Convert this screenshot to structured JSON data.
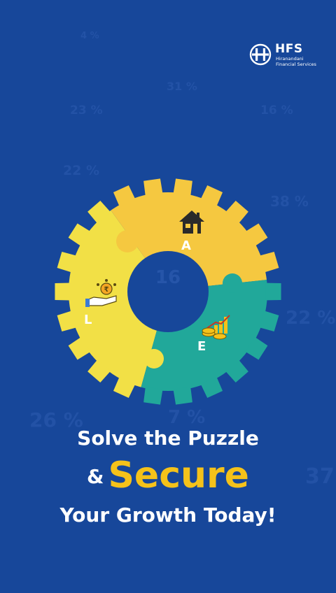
{
  "brand": {
    "name": "HFS",
    "subtitle_line1": "Hiranandani",
    "subtitle_line2": "Financial Services"
  },
  "background_numbers": [
    "4 %",
    "31 %",
    "23 %",
    "16 %",
    "22 %",
    "38 %",
    "16",
    "22 %",
    "26 %",
    "7 %",
    "37"
  ],
  "puzzle": {
    "pieces": [
      {
        "letter": "A",
        "icon": "house-icon",
        "color": "#f5c840"
      },
      {
        "letter": "L",
        "icon": "hand-rupee-icon",
        "color": "#f2e046"
      },
      {
        "letter": "E",
        "icon": "growth-chart-coins-icon",
        "color": "#21a89a"
      }
    ]
  },
  "headline": {
    "line1": "Solve the Puzzle",
    "amp": "&",
    "highlight": "Secure",
    "line3": "Your Growth Today!"
  },
  "colors": {
    "background": "#17479a",
    "highlight": "#f5c21a"
  }
}
